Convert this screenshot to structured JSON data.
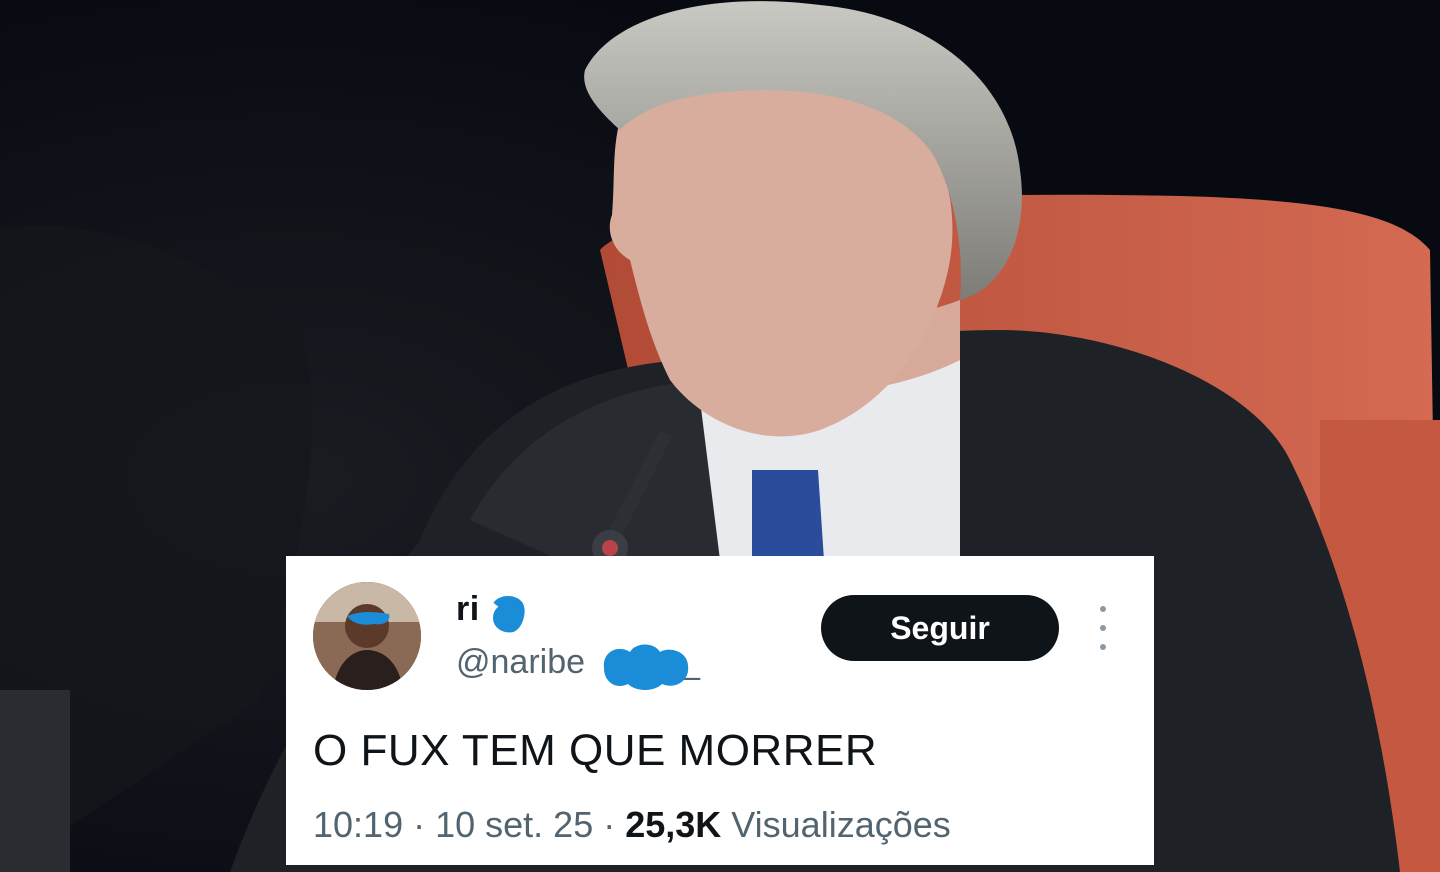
{
  "colors": {
    "background": "#0b0d14",
    "chair": "#c85a44",
    "robe": "#1e2226",
    "tie": "#2b4c9a",
    "redaction_scribble": "#1a8cd8",
    "follow_button_bg": "#0f1419",
    "follow_button_text": "#ffffff",
    "text_primary": "#0f1419",
    "text_secondary": "#536471"
  },
  "tweet": {
    "display_name": "ri",
    "handle_prefix": "@naribe",
    "handle_suffix": "_",
    "follow_label": "Seguir",
    "more_icon": "more-vertical-icon",
    "text": "O FUX TEM QUE MORRER",
    "time": "10:19",
    "separator_1": " · ",
    "date": "10 set. 25",
    "separator_2": " · ",
    "views_count": "25,3K",
    "views_label": " Visualizações"
  }
}
